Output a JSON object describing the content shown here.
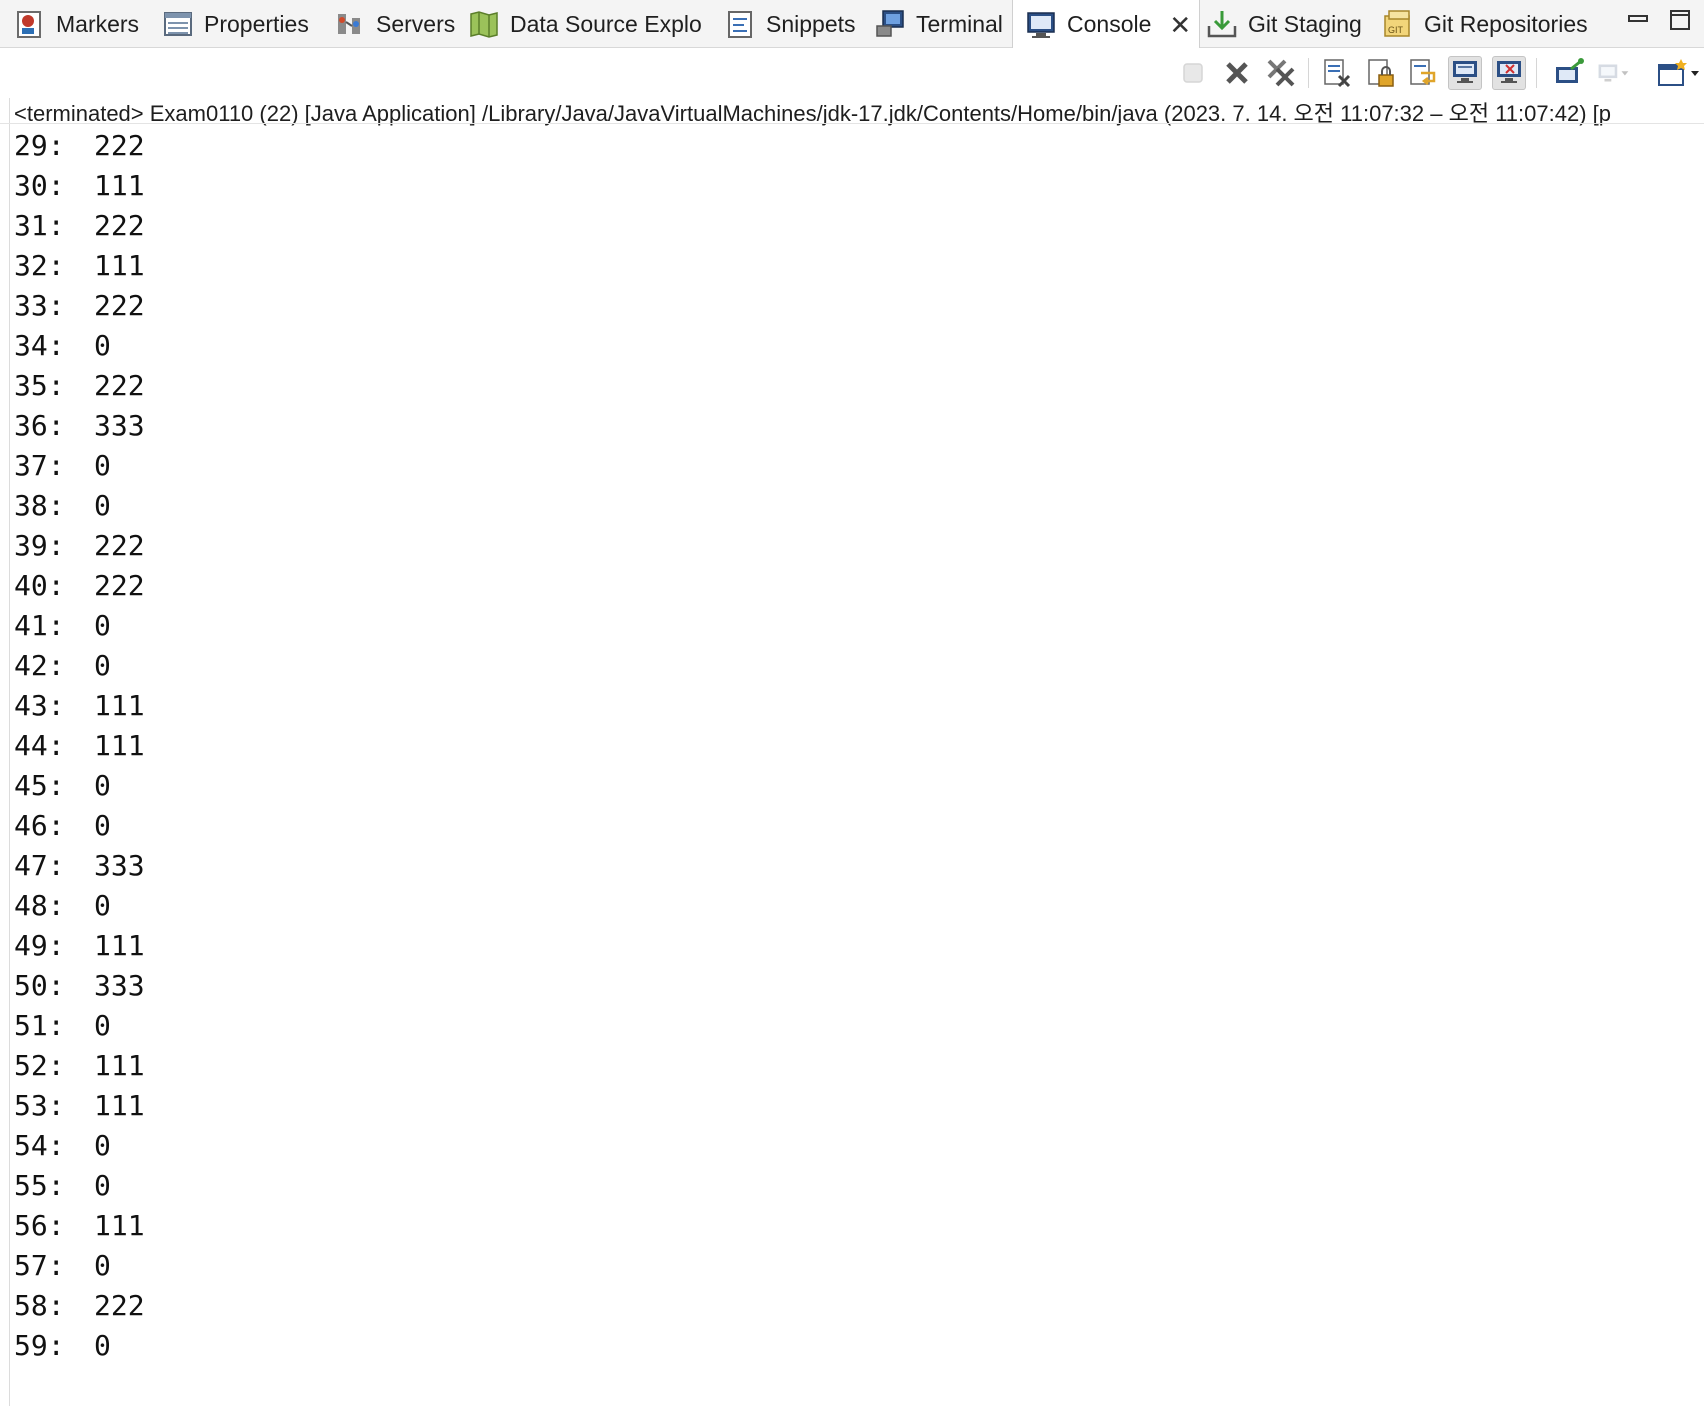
{
  "tabs": [
    {
      "label": "Markers",
      "icon": "markers-icon",
      "active": false
    },
    {
      "label": "Properties",
      "icon": "properties-icon",
      "active": false
    },
    {
      "label": "Servers",
      "icon": "servers-icon",
      "active": false
    },
    {
      "label": "Data Source Explo",
      "icon": "data-source-explorer-icon",
      "active": false
    },
    {
      "label": "Snippets",
      "icon": "snippets-icon",
      "active": false
    },
    {
      "label": "Terminal",
      "icon": "terminal-icon",
      "active": false
    },
    {
      "label": "Console",
      "icon": "console-icon",
      "active": true
    },
    {
      "label": "Git Staging",
      "icon": "git-staging-icon",
      "active": false
    },
    {
      "label": "Git Repositories",
      "icon": "git-repositories-icon",
      "active": false
    }
  ],
  "window_controls": {
    "minimize": "minimize-icon",
    "maximize": "maximize-icon"
  },
  "toolbar_icons": [
    "terminate-icon",
    "remove-launch-icon",
    "remove-all-terminated-icon",
    "clear-console-icon",
    "scroll-lock-icon",
    "word-wrap-icon",
    "show-on-stdout-icon",
    "show-on-stderr-icon",
    "pin-console-icon",
    "display-selected-console-icon",
    "open-console-icon"
  ],
  "status_line": "<terminated> Exam0110 (22) [Java Application] /Library/Java/JavaVirtualMachines/jdk-17.jdk/Contents/Home/bin/java  (2023. 7. 14. 오전 11:07:32 – 오전 11:07:42) [p",
  "console_lines": [
    {
      "num": "29:",
      "val": "222"
    },
    {
      "num": "30:",
      "val": "111"
    },
    {
      "num": "31:",
      "val": "222"
    },
    {
      "num": "32:",
      "val": "111"
    },
    {
      "num": "33:",
      "val": "222"
    },
    {
      "num": "34:",
      "val": "0"
    },
    {
      "num": "35:",
      "val": "222"
    },
    {
      "num": "36:",
      "val": "333"
    },
    {
      "num": "37:",
      "val": "0"
    },
    {
      "num": "38:",
      "val": "0"
    },
    {
      "num": "39:",
      "val": "222"
    },
    {
      "num": "40:",
      "val": "222"
    },
    {
      "num": "41:",
      "val": "0"
    },
    {
      "num": "42:",
      "val": "0"
    },
    {
      "num": "43:",
      "val": "111"
    },
    {
      "num": "44:",
      "val": "111"
    },
    {
      "num": "45:",
      "val": "0"
    },
    {
      "num": "46:",
      "val": "0"
    },
    {
      "num": "47:",
      "val": "333"
    },
    {
      "num": "48:",
      "val": "0"
    },
    {
      "num": "49:",
      "val": "111"
    },
    {
      "num": "50:",
      "val": "333"
    },
    {
      "num": "51:",
      "val": "0"
    },
    {
      "num": "52:",
      "val": "111"
    },
    {
      "num": "53:",
      "val": "111"
    },
    {
      "num": "54:",
      "val": "0"
    },
    {
      "num": "55:",
      "val": "0"
    },
    {
      "num": "56:",
      "val": "111"
    },
    {
      "num": "57:",
      "val": "0"
    },
    {
      "num": "58:",
      "val": "222"
    },
    {
      "num": "59:",
      "val": "0"
    }
  ]
}
